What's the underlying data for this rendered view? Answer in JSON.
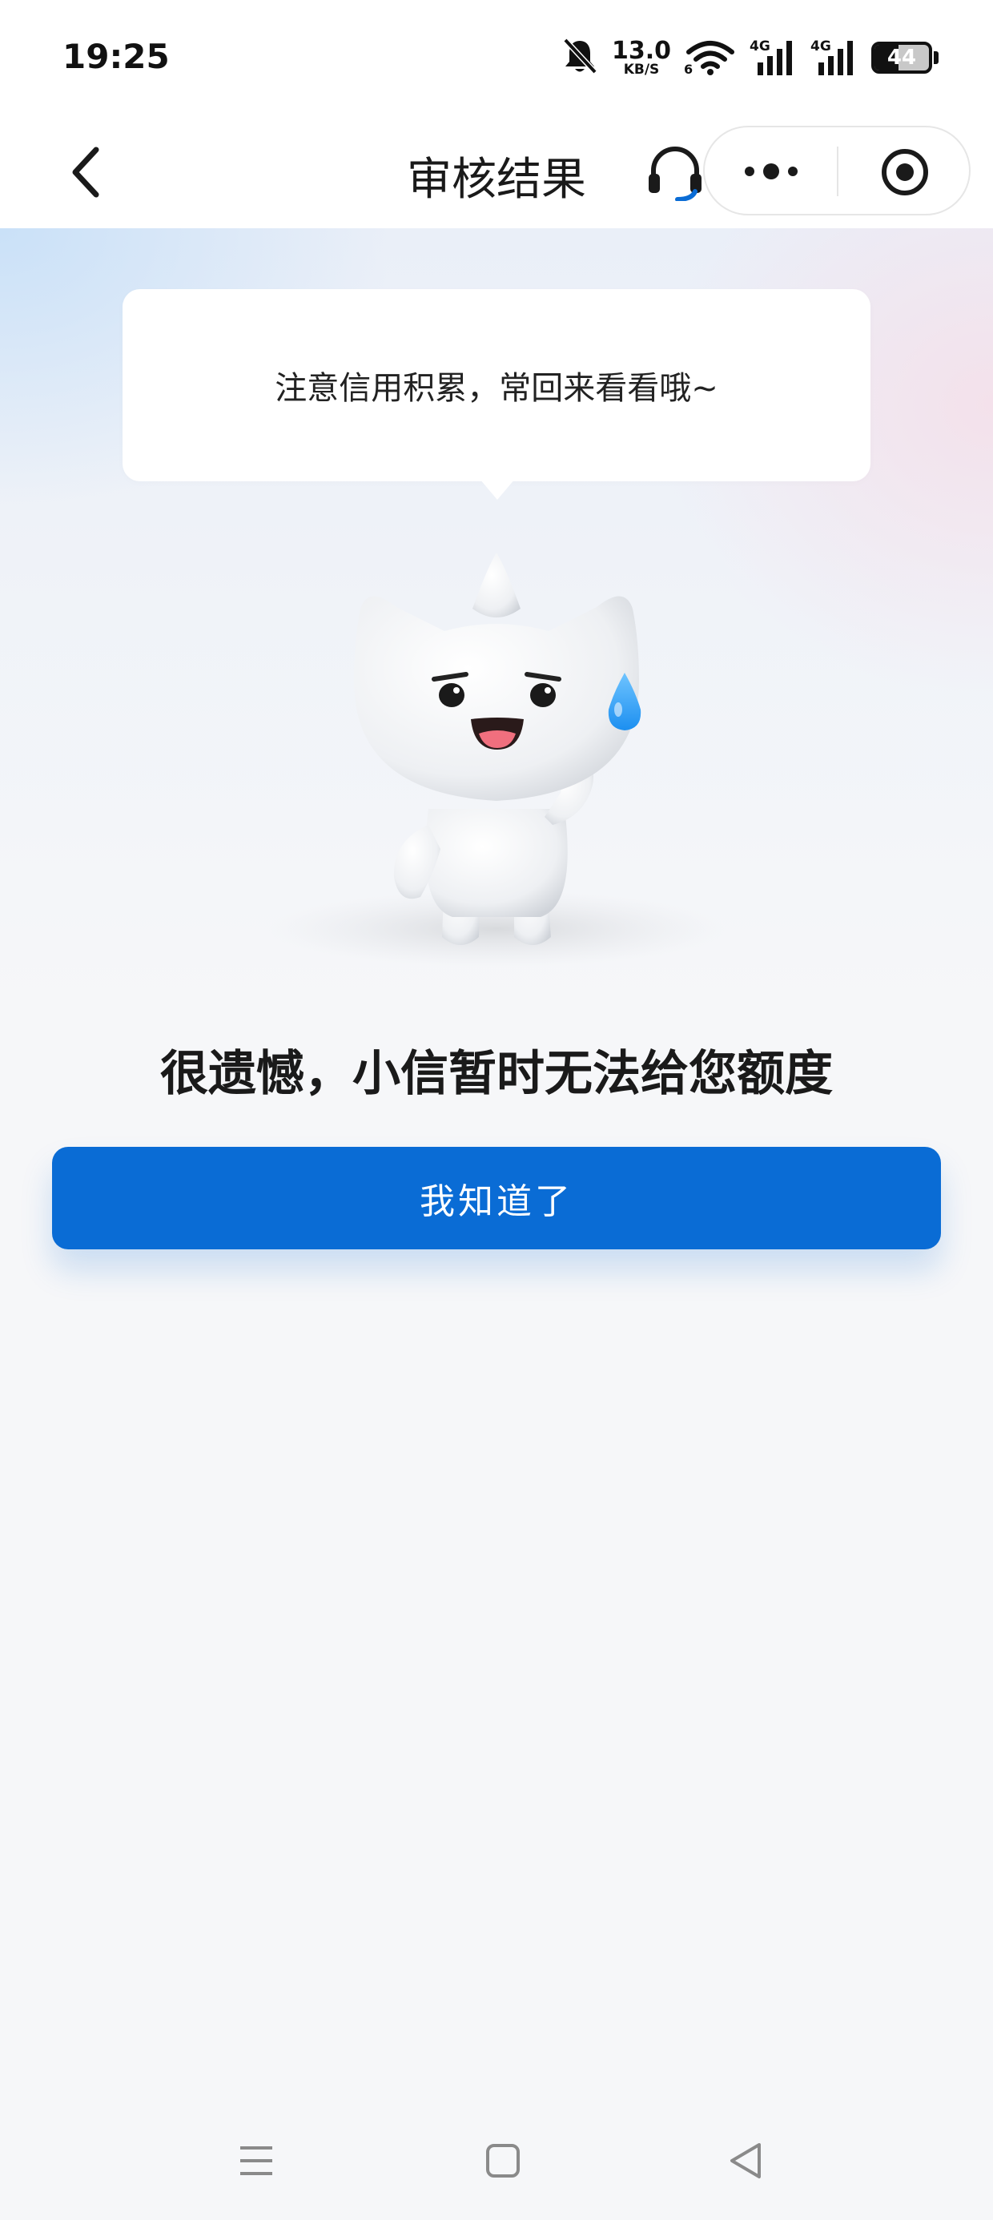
{
  "status_bar": {
    "time": "19:25",
    "net_speed_value": "13.0",
    "net_speed_unit": "KB/S",
    "wifi_badge": "6",
    "signal1_label": "4G",
    "signal2_label": "4G",
    "battery_level": "44",
    "battery_fraction": 0.44,
    "icons": [
      "bell-muted-icon",
      "wifi-icon",
      "signal-icon",
      "signal-icon",
      "battery-icon"
    ]
  },
  "nav": {
    "title": "审核结果",
    "icons": [
      "back-arrow-icon",
      "headset-icon",
      "more-dots-icon",
      "target-circle-icon"
    ]
  },
  "bubble": {
    "text": "注意信用积累，常回来看看哦~"
  },
  "result": {
    "title": "很遗憾，小信暂时无法给您额度",
    "button_label": "我知道了"
  },
  "colors": {
    "primary": "#0a6cd5",
    "page_bg": "#f6f7f9",
    "sweat_drop": "#1c8ff0"
  },
  "system_nav": {
    "icons": [
      "menu-lines-icon",
      "home-square-icon",
      "back-triangle-icon"
    ]
  }
}
